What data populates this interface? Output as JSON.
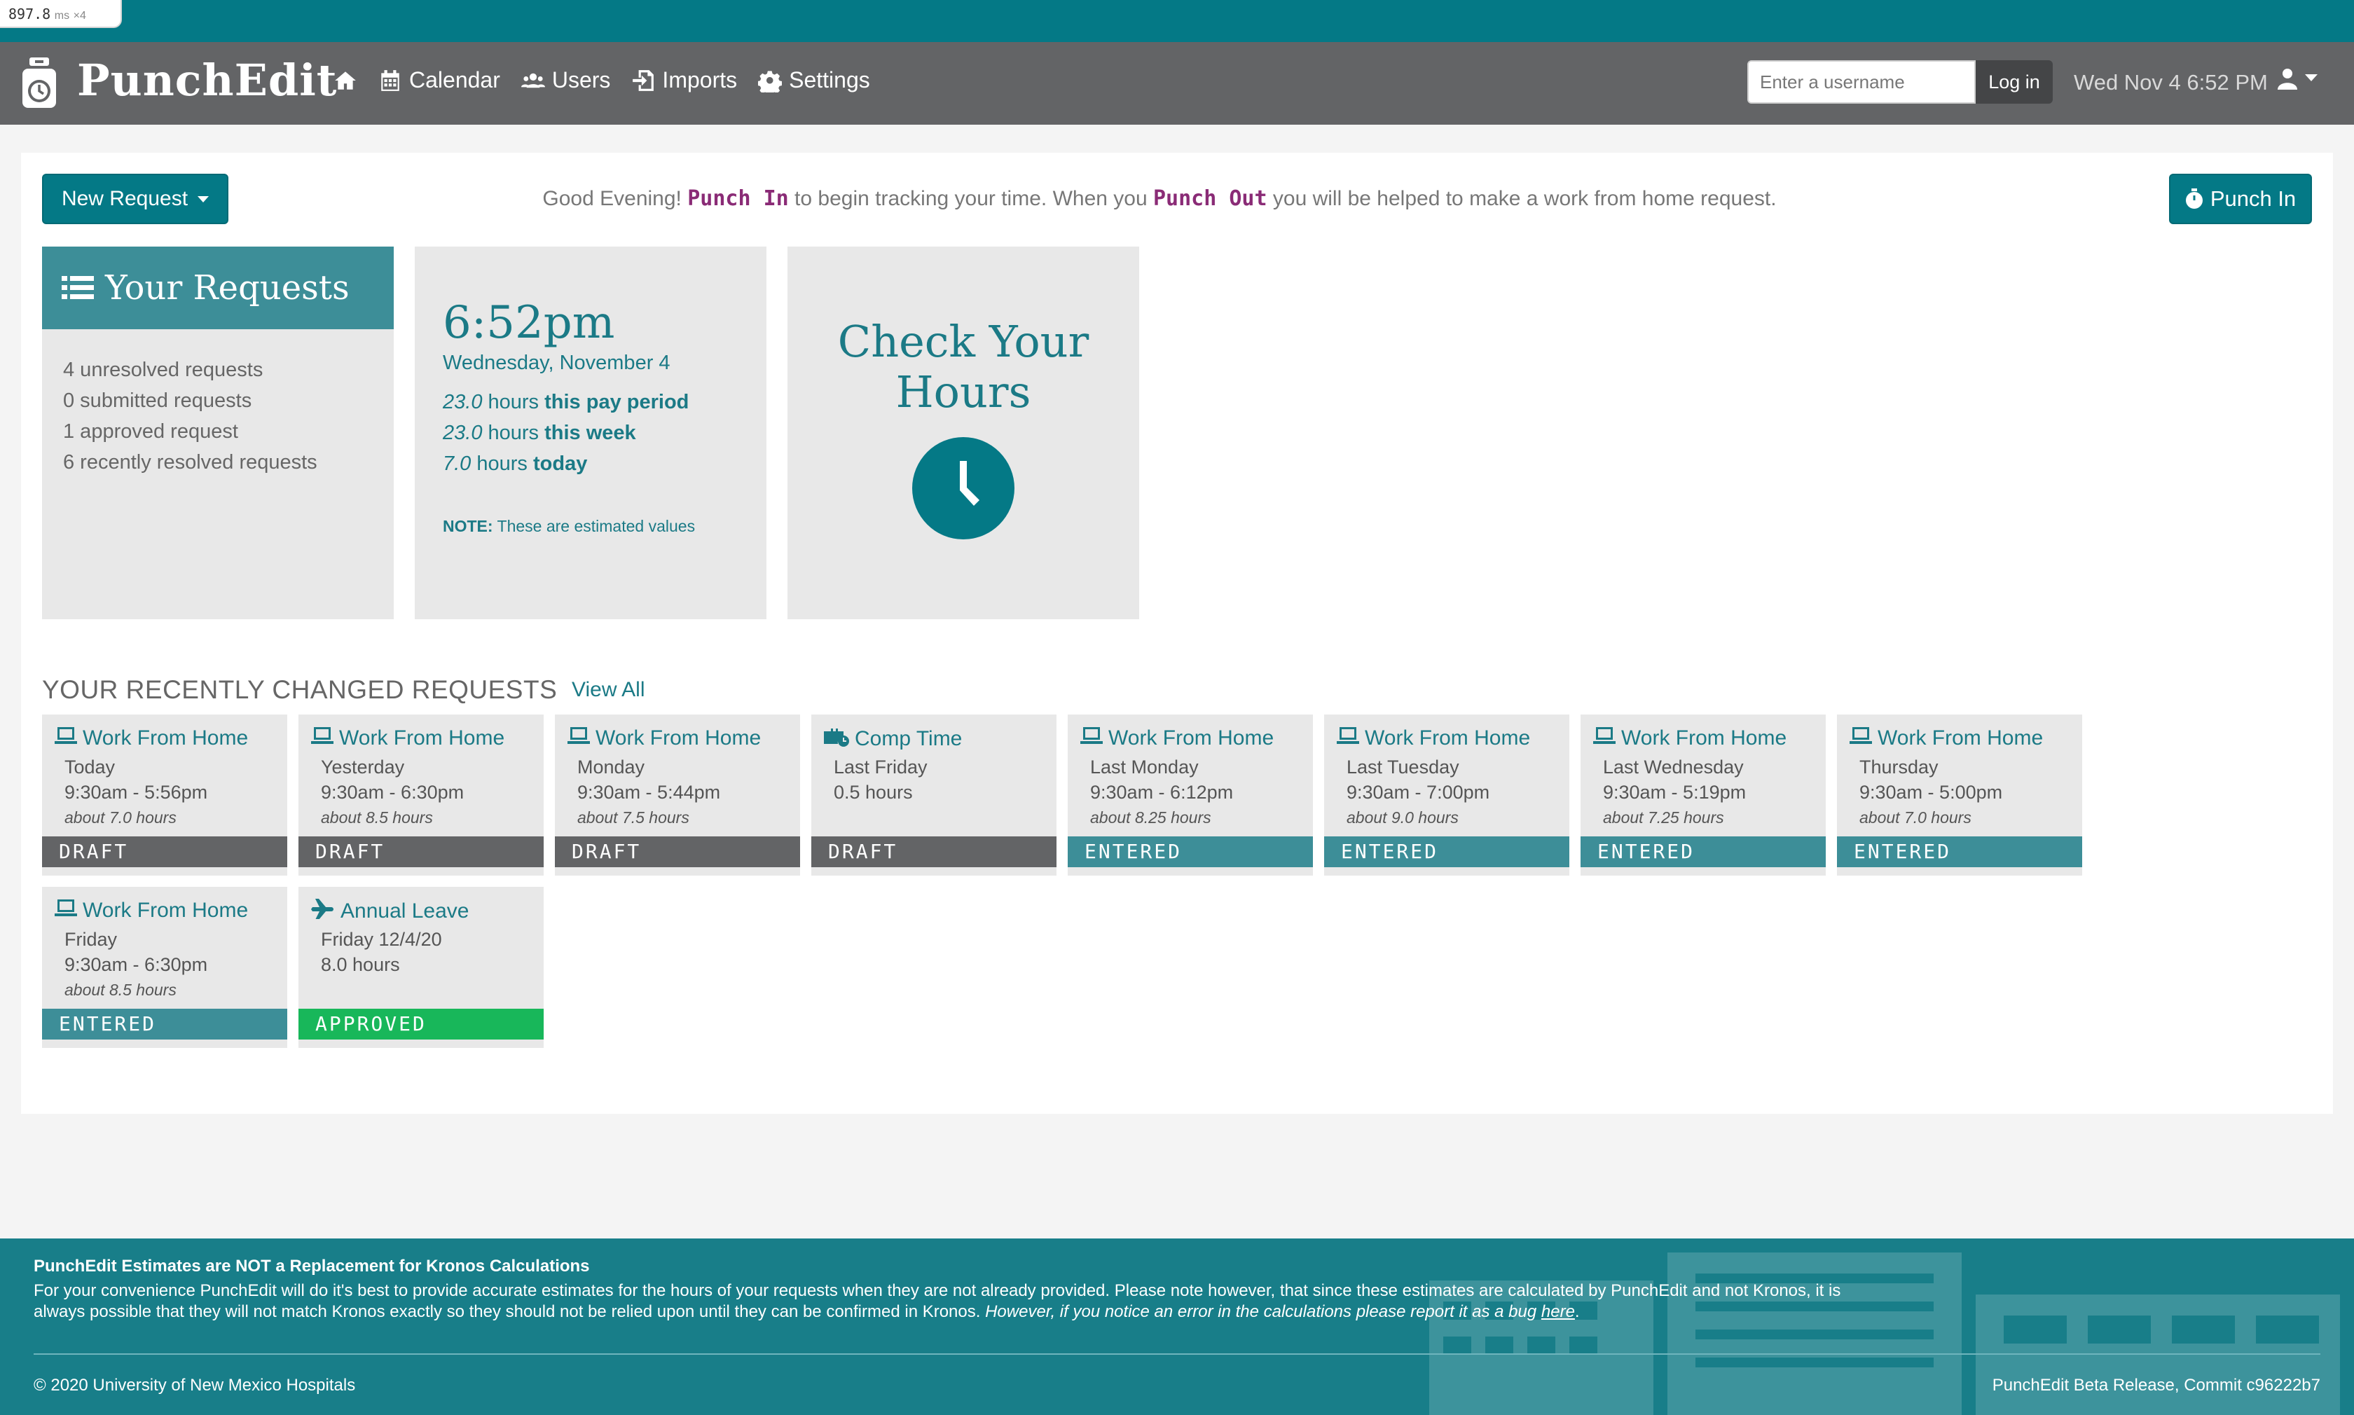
{
  "perf": {
    "value": "897.8",
    "unit": "ms",
    "multiplier": "×4"
  },
  "brand": {
    "name": "PunchEdit"
  },
  "nav": {
    "home_icon": "home-icon",
    "links": [
      {
        "label": "Calendar",
        "icon": "calendar-icon"
      },
      {
        "label": "Users",
        "icon": "users-icon"
      },
      {
        "label": "Imports",
        "icon": "import-icon"
      },
      {
        "label": "Settings",
        "icon": "gear-icon"
      }
    ],
    "username_placeholder": "Enter a username",
    "login_label": "Log in",
    "datetime": "Wed Nov 4 6:52 PM",
    "user_icon": "user-icon"
  },
  "toolbar": {
    "new_request_label": "New Request",
    "greeting_prefix": "Good Evening! ",
    "punch_in_word": "Punch In",
    "greeting_mid": " to begin tracking your time. When you ",
    "punch_out_word": "Punch Out",
    "greeting_suffix": " you will be helped to make a work from home request.",
    "punch_in_label": "Punch In"
  },
  "your_requests": {
    "title": "Your Requests",
    "items": [
      "4 unresolved requests",
      "0 submitted requests",
      "1 approved request",
      "6 recently resolved requests"
    ]
  },
  "time_card": {
    "time": "6:52pm",
    "date": "Wednesday, November 4",
    "lines": [
      {
        "value": "23.0",
        "unit": " hours ",
        "period": "this pay period"
      },
      {
        "value": "23.0",
        "unit": " hours ",
        "period": "this week"
      },
      {
        "value": "7.0",
        "unit": " hours ",
        "period": "today"
      }
    ],
    "note_label": "NOTE:",
    "note_text": " These are estimated values"
  },
  "check_hours": {
    "title_line1": "Check Your",
    "title_line2": "Hours"
  },
  "recent": {
    "title": "YOUR RECENTLY CHANGED REQUESTS",
    "view_all": "View All",
    "requests": [
      {
        "type": "Work From Home",
        "icon": "laptop-icon",
        "day": "Today",
        "range": "9:30am - 5:56pm",
        "about": "about 7.0 hours",
        "status": "DRAFT"
      },
      {
        "type": "Work From Home",
        "icon": "laptop-icon",
        "day": "Yesterday",
        "range": "9:30am - 6:30pm",
        "about": "about 8.5 hours",
        "status": "DRAFT"
      },
      {
        "type": "Work From Home",
        "icon": "laptop-icon",
        "day": "Monday",
        "range": "9:30am - 5:44pm",
        "about": "about 7.5 hours",
        "status": "DRAFT"
      },
      {
        "type": "Comp Time",
        "icon": "briefcase-clock-icon",
        "day": "Last Friday",
        "range": "0.5 hours",
        "about": "",
        "status": "DRAFT"
      },
      {
        "type": "Work From Home",
        "icon": "laptop-icon",
        "day": "Last Monday",
        "range": "9:30am - 6:12pm",
        "about": "about 8.25 hours",
        "status": "ENTERED"
      },
      {
        "type": "Work From Home",
        "icon": "laptop-icon",
        "day": "Last Tuesday",
        "range": "9:30am - 7:00pm",
        "about": "about 9.0 hours",
        "status": "ENTERED"
      },
      {
        "type": "Work From Home",
        "icon": "laptop-icon",
        "day": "Last Wednesday",
        "range": "9:30am - 5:19pm",
        "about": "about 7.25 hours",
        "status": "ENTERED"
      },
      {
        "type": "Work From Home",
        "icon": "laptop-icon",
        "day": "Thursday",
        "range": "9:30am - 5:00pm",
        "about": "about 7.0 hours",
        "status": "ENTERED"
      },
      {
        "type": "Work From Home",
        "icon": "laptop-icon",
        "day": "Friday",
        "range": "9:30am - 6:30pm",
        "about": "about 8.5 hours",
        "status": "ENTERED"
      },
      {
        "type": "Annual Leave",
        "icon": "plane-icon",
        "day": "Friday 12/4/20",
        "range": "8.0 hours",
        "about": "",
        "status": "APPROVED"
      }
    ]
  },
  "footer": {
    "heading": "PunchEdit Estimates are NOT a Replacement for Kronos Calculations",
    "body": "For your convenience PunchEdit will do it's best to provide accurate estimates for the hours of your requests when they are not already provided. Please note however, that since these estimates are calculated by PunchEdit and not Kronos, it is always possible that they will not match Kronos exactly so they should not be relied upon until they can be confirmed in Kronos. ",
    "body_italic": "However, if you notice an error in the calculations please report it as a bug ",
    "bug_link": "here",
    "body_end": ".",
    "copyright": "© 2020 University of New Mexico Hospitals",
    "release": "PunchEdit Beta Release, Commit c96222b7"
  },
  "colors": {
    "brand_teal": "#047986",
    "nav_gray": "#636466",
    "draft": "#636466",
    "entered": "#3d8e98",
    "approved": "#18b75a",
    "punch_accent": "#8a2b76"
  }
}
